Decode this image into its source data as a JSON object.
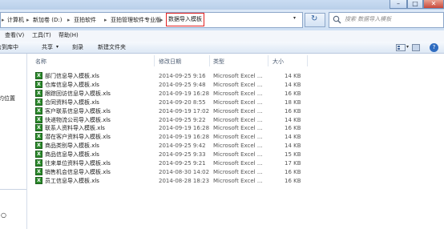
{
  "window": {
    "minimize": "–",
    "maximize": "□",
    "close": "✕"
  },
  "breadcrumb": [
    {
      "label": "计算机"
    },
    {
      "label": "新加卷 (D:)"
    },
    {
      "label": "亚拍软件"
    },
    {
      "label": "亚拍管理软件专业版"
    },
    {
      "label": "数据导入模板",
      "active": true
    }
  ],
  "address": {
    "separator": "▸",
    "refresh": "↻"
  },
  "search": {
    "placeholder": "搜索 数据导入模板"
  },
  "menu": {
    "view": "查看(V)",
    "tools": "工具(T)",
    "help": "帮助(H)"
  },
  "toolbar": {
    "include": "包含到库中",
    "share": "共享",
    "share_arrow": "▾",
    "burn": "刻录",
    "new_folder": "新建文件夹"
  },
  "nav": {
    "partial_label": "约位置",
    "bottom_partial": "○"
  },
  "columns": {
    "name": "名称",
    "modified": "修改日期",
    "type": "类型",
    "size": "大小"
  },
  "files": [
    {
      "name": "部门信息导入模板.xls",
      "date": "2014-09-25 9:16",
      "type": "Microsoft Excel ...",
      "size": "14 KB"
    },
    {
      "name": "仓库信息导入模板.xls",
      "date": "2014-09-25 9:48",
      "type": "Microsoft Excel ...",
      "size": "14 KB"
    },
    {
      "name": "跟踪回访信息导入模板.xls",
      "date": "2014-09-19 16:28",
      "type": "Microsoft Excel ...",
      "size": "16 KB"
    },
    {
      "name": "合同资料导入模板.xls",
      "date": "2014-09-20 8:55",
      "type": "Microsoft Excel ...",
      "size": "18 KB"
    },
    {
      "name": "客户联系信息导入模板.xls",
      "date": "2014-09-19 17:02",
      "type": "Microsoft Excel ...",
      "size": "16 KB"
    },
    {
      "name": "快递物流公司导入模板.xls",
      "date": "2014-09-25 9:22",
      "type": "Microsoft Excel ...",
      "size": "14 KB"
    },
    {
      "name": "联系人资料导入模板.xls",
      "date": "2014-09-19 16:28",
      "type": "Microsoft Excel ...",
      "size": "16 KB"
    },
    {
      "name": "潜在客户资料导入模板.xls",
      "date": "2014-09-19 16:28",
      "type": "Microsoft Excel ...",
      "size": "14 KB"
    },
    {
      "name": "商品类别导入模板.xls",
      "date": "2014-09-25 9:42",
      "type": "Microsoft Excel ...",
      "size": "14 KB"
    },
    {
      "name": "商品信息导入模板.xls",
      "date": "2014-09-25 9:33",
      "type": "Microsoft Excel ...",
      "size": "15 KB"
    },
    {
      "name": "往来单位资料导入模板.xls",
      "date": "2014-09-25 9:21",
      "type": "Microsoft Excel ...",
      "size": "17 KB"
    },
    {
      "name": "销售机会信息导入模板.xls",
      "date": "2014-08-30 14:02",
      "type": "Microsoft Excel ...",
      "size": "16 KB"
    },
    {
      "name": "员工信息导入模板.xls",
      "date": "2014-08-28 18:23",
      "type": "Microsoft Excel ...",
      "size": "16 KB"
    }
  ]
}
